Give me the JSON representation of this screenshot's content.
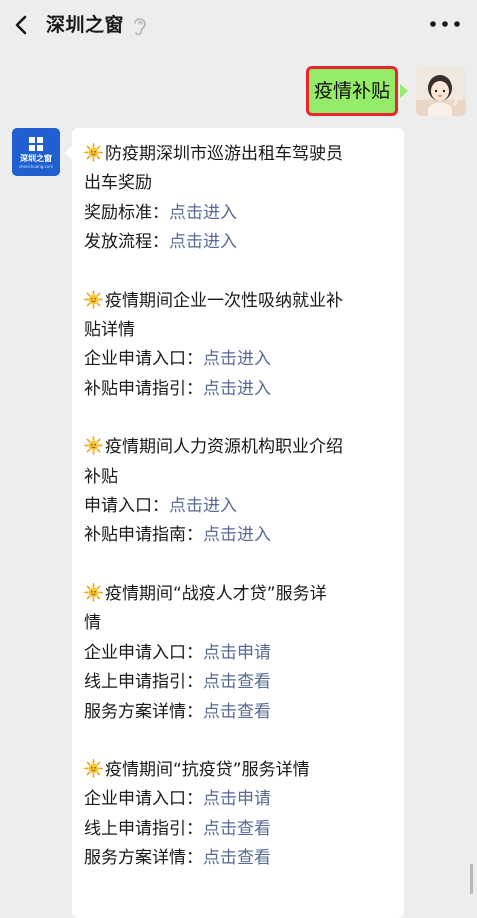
{
  "header": {
    "title": "深圳之窗"
  },
  "sent_message": {
    "text": "疫情补贴"
  },
  "avatar_logo": {
    "name": "深圳之窗",
    "sub": "shenchuang.com"
  },
  "reply": {
    "sections": [
      {
        "title": "防疫期深圳市巡游出租车驾驶员出车奖励",
        "title_lines": [
          "防疫期深圳市巡游出租车驾驶员",
          "出车奖励"
        ],
        "items": [
          {
            "label": "奖励标准：",
            "link": "点击进入"
          },
          {
            "label": "发放流程：",
            "link": "点击进入"
          }
        ]
      },
      {
        "title": "疫情期间企业一次性吸纳就业补贴详情",
        "title_lines": [
          "疫情期间企业一次性吸纳就业补",
          "贴详情"
        ],
        "items": [
          {
            "label": "企业申请入口：",
            "link": "点击进入"
          },
          {
            "label": "补贴申请指引：",
            "link": "点击进入"
          }
        ]
      },
      {
        "title": "疫情期间人力资源机构职业介绍补贴",
        "title_lines": [
          "疫情期间人力资源机构职业介绍",
          "补贴"
        ],
        "items": [
          {
            "label": "申请入口：",
            "link": "点击进入"
          },
          {
            "label": "补贴申请指南：",
            "link": "点击进入"
          }
        ]
      },
      {
        "title": "疫情期间“战疫人才贷”服务详情",
        "title_lines": [
          "疫情期间“战疫人才贷”服务详",
          "情"
        ],
        "items": [
          {
            "label": "企业申请入口：",
            "link": "点击申请"
          },
          {
            "label": "线上申请指引：",
            "link": "点击查看"
          },
          {
            "label": "服务方案详情：",
            "link": "点击查看"
          }
        ]
      },
      {
        "title": "疫情期间“抗疫贷”服务详情",
        "title_lines": [
          "疫情期间“抗疫贷”服务详情"
        ],
        "items": [
          {
            "label": "企业申请入口：",
            "link": "点击申请"
          },
          {
            "label": "线上申请指引：",
            "link": "点击查看"
          },
          {
            "label": "服务方案详情：",
            "link": "点击查看"
          }
        ]
      }
    ]
  },
  "icons": {
    "back": "chevron-left-icon",
    "ear": "ear-icon",
    "more": "more-dots-icon",
    "emoji": "sun-emoji-icon"
  },
  "colors": {
    "background": "#ededed",
    "sent_bubble": "#95ec69",
    "highlight_border": "#e8262b",
    "link": "#576b95",
    "logo_blue": "#1f5fcf"
  }
}
